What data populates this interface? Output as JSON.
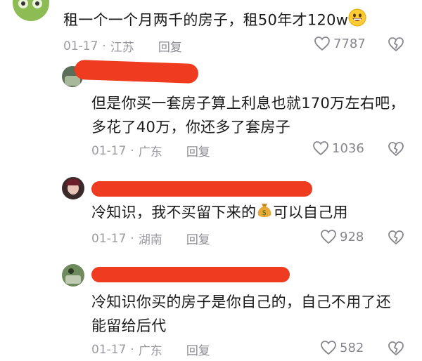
{
  "comments": [
    {
      "text": "租一个一个月两千的房子，租50年才120w",
      "emoji": "grinning-face-emoji",
      "date": "01-17",
      "location": "江苏",
      "reply_label": "回复",
      "likes": "7787"
    },
    {
      "text_line1": "但是你买一套房子算上利息也就170万左右吧，",
      "text_line2": "多花了40万，你还多了套房子",
      "date": "01-17",
      "location": "广东",
      "reply_label": "回复",
      "likes": "1036"
    },
    {
      "text_before": "冷知识，我不买留下来的",
      "emoji": "money-bag-emoji",
      "text_after": "可以自己用",
      "date": "01-17",
      "location": "湖南",
      "reply_label": "回复",
      "likes": "928"
    },
    {
      "text_line1": "冷知识你买的房子是你自己的，自己不用了还",
      "text_line2": "能留给后代",
      "date": "01-17",
      "location": "广东",
      "reply_label": "回复",
      "likes": "582"
    }
  ],
  "colors": {
    "redaction": "#ef3b1f",
    "meta_text": "#9a9aa0"
  }
}
